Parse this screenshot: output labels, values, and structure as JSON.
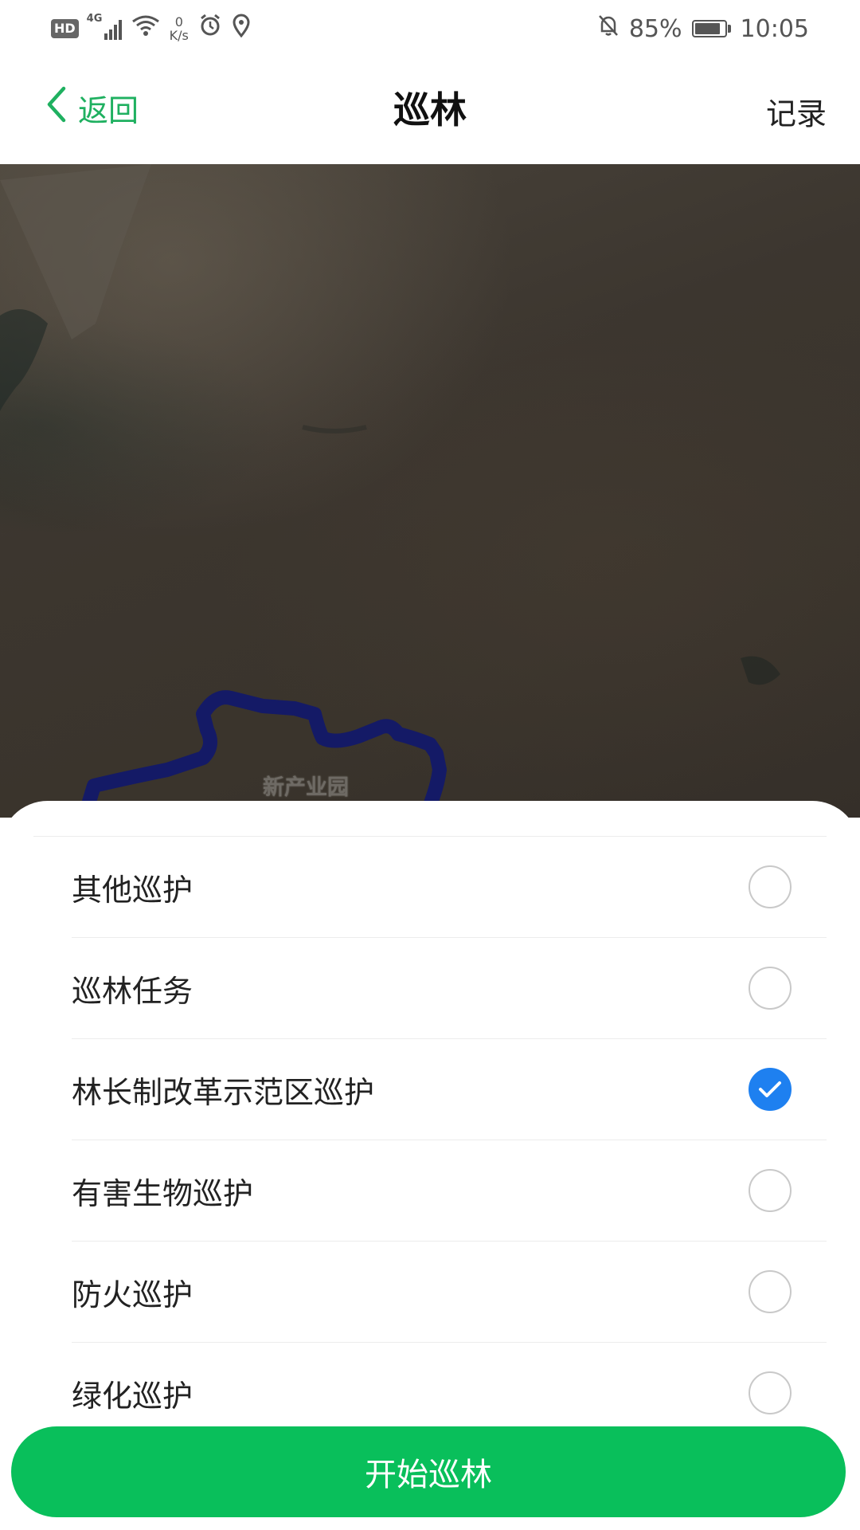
{
  "status_bar": {
    "hd": "HD",
    "network": "4G",
    "speed_value": "0",
    "speed_unit": "K/s",
    "battery_percent": "85%",
    "battery_level": 0.85,
    "time": "10:05",
    "icons": [
      "signal-icon",
      "wifi-icon",
      "alarm-icon",
      "location-icon",
      "bell-off-icon",
      "battery-icon"
    ]
  },
  "nav": {
    "back_label": "返回",
    "title": "巡林",
    "record_label": "记录",
    "accent_color": "#1fb060"
  },
  "map": {
    "label": "新产业园",
    "route_color": "#141a66"
  },
  "options": [
    {
      "label": "其他巡护",
      "checked": false
    },
    {
      "label": "巡林任务",
      "checked": false
    },
    {
      "label": "林长制改革示范区巡护",
      "checked": true
    },
    {
      "label": "有害生物巡护",
      "checked": false
    },
    {
      "label": "防火巡护",
      "checked": false
    },
    {
      "label": "绿化巡护",
      "checked": false
    }
  ],
  "radio_checked_color": "#1e80f0",
  "start_button": {
    "label": "开始巡林",
    "color": "#09bf5b"
  }
}
